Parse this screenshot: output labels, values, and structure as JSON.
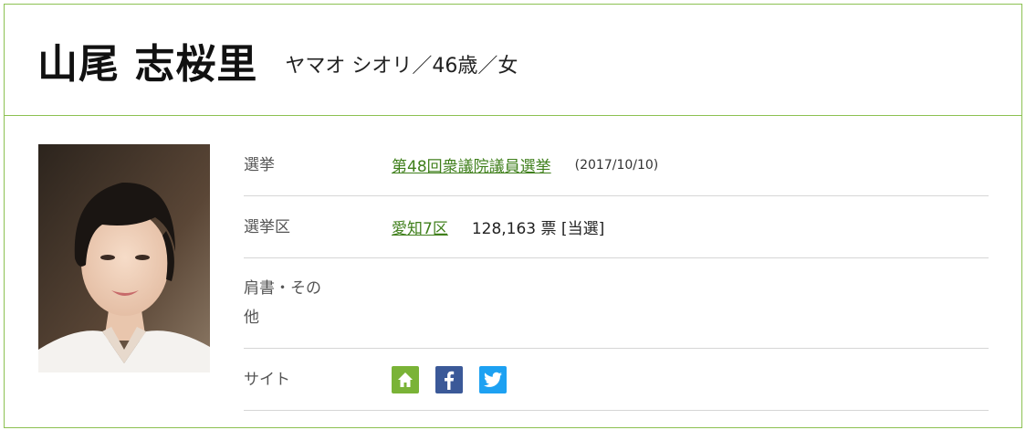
{
  "candidate": {
    "name": "山尾 志桜里",
    "reading": "ヤマオ シオリ／46歳／女"
  },
  "details": {
    "election_label": "選挙",
    "election_link": "第48回衆議院議員選挙",
    "election_date": "(2017/10/10)",
    "district_label": "選挙区",
    "district_link": "愛知7区",
    "votes": "128,163 票 [当選]",
    "title_label": "肩書・その他",
    "title_value": "",
    "site_label": "サイト"
  },
  "site_icons": [
    {
      "name": "home-icon",
      "color": "#7ab337"
    },
    {
      "name": "facebook-icon",
      "color": "#3b5998"
    },
    {
      "name": "twitter-icon",
      "color": "#1da1f2"
    }
  ],
  "colors": {
    "border": "#8cc152",
    "link": "#3f7f1b"
  }
}
